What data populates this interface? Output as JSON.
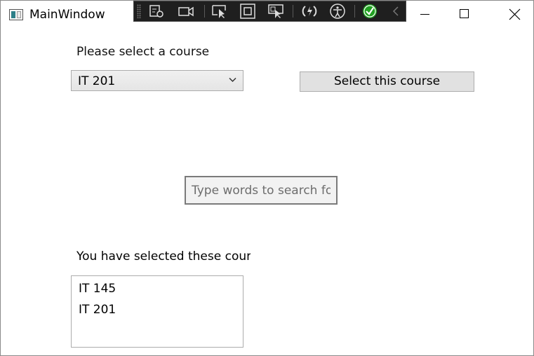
{
  "window": {
    "title": "MainWindow"
  },
  "toolbar": {
    "icons": [
      "live-visual-tree-icon",
      "record-icon",
      "select-element-icon",
      "display-layout-adorners-icon",
      "track-focused-element-icon",
      "hot-reload-icon",
      "accessibility-icon",
      "binding-check-icon",
      "collapse-chevron-icon"
    ]
  },
  "main": {
    "course_prompt": "Please select a course",
    "course_select": {
      "value": "IT 201"
    },
    "select_button_label": "Select this course",
    "search": {
      "placeholder": "Type words to search for"
    },
    "selected_label": "You have selected these courses",
    "selected_courses": [
      "IT 145",
      "IT 201"
    ]
  },
  "colors": {
    "check_green": "#21a121",
    "toolbar_bg": "#1f1f1f"
  }
}
